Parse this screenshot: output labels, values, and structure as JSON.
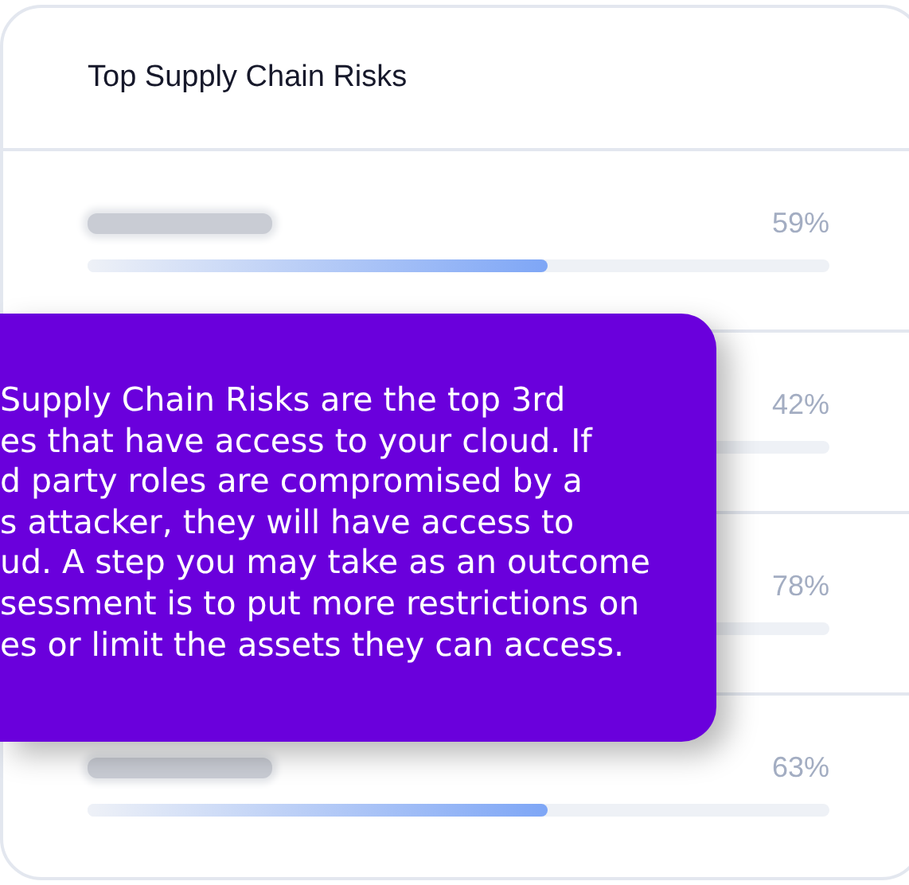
{
  "card": {
    "title": "Top Supply Chain Risks",
    "rows": [
      {
        "percent": "59%",
        "level": 0.62,
        "name_hidden": true
      },
      {
        "percent": "42%"
      },
      {
        "percent": "78%"
      },
      {
        "percent": "63%",
        "level": 0.62,
        "name_hidden": true
      }
    ]
  },
  "tooltip": {
    "lines": [
      "Supply Chain Risks are the top 3rd",
      "es that have access to your cloud. If",
      "d party roles are compromised by a",
      "s attacker, they will have access to",
      "ud. A step you may take as an outcome",
      "sessment is to put more restrictions on",
      "es or limit the assets they can access."
    ]
  }
}
